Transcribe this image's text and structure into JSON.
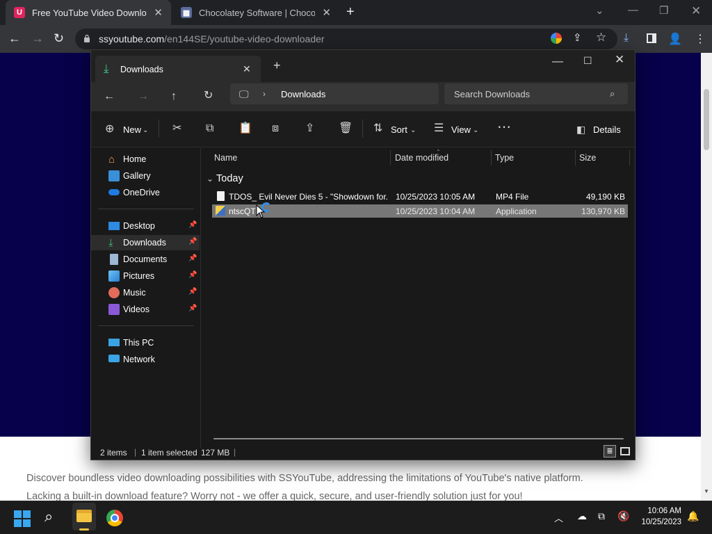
{
  "browser": {
    "tabs": [
      {
        "title": "Free YouTube Video Downloader",
        "favicon": "ssyoutube-logo-icon"
      },
      {
        "title": "Chocolatey Software | Chocolatey",
        "favicon": "chocolatey-logo-icon"
      }
    ],
    "url_domain": "ssyoutube.com",
    "url_path": "/en144SE/youtube-video-downloader"
  },
  "webpage": {
    "line1": "Discover boundless video downloading possibilities with SSYouTube, addressing the limitations of YouTube's native platform.",
    "line2": "Lacking a built-in download feature? Worry not - we offer a quick, secure, and user-friendly solution just for you!",
    "hero_color": "#07004a"
  },
  "explorer": {
    "tab_title": "Downloads",
    "breadcrumb": "Downloads",
    "search_placeholder": "Search Downloads",
    "commands": {
      "new": "New",
      "sort": "Sort",
      "view": "View",
      "details": "Details"
    },
    "nav_group1": [
      {
        "label": "Home",
        "icon": "home-icon"
      },
      {
        "label": "Gallery",
        "icon": "gallery-icon"
      },
      {
        "label": "OneDrive",
        "icon": "onedrive-icon"
      }
    ],
    "nav_group2": [
      {
        "label": "Desktop",
        "icon": "desktop-icon"
      },
      {
        "label": "Downloads",
        "icon": "download-arrow-icon",
        "selected": true
      },
      {
        "label": "Documents",
        "icon": "documents-icon"
      },
      {
        "label": "Pictures",
        "icon": "pictures-icon"
      },
      {
        "label": "Music",
        "icon": "music-icon"
      },
      {
        "label": "Videos",
        "icon": "videos-icon"
      }
    ],
    "nav_group3": [
      {
        "label": "This PC",
        "icon": "this-pc-icon"
      },
      {
        "label": "Network",
        "icon": "network-icon"
      }
    ],
    "columns": {
      "name": "Name",
      "date": "Date modified",
      "type": "Type",
      "size": "Size"
    },
    "group_label": "Today",
    "files": [
      {
        "name": "TDOS_ Evil Never Dies 5 - \"Showdown for...",
        "date": "10/25/2023 10:05 AM",
        "type": "MP4 File",
        "size": "49,190 KB",
        "selected": false
      },
      {
        "name": "ntscQT",
        "date": "10/25/2023 10:04 AM",
        "type": "Application",
        "size": "130,970 KB",
        "selected": true
      }
    ],
    "status": {
      "items": "2 items",
      "selected": "1 item selected",
      "size": "127 MB"
    }
  },
  "taskbar": {
    "time": "10:06 AM",
    "date": "10/25/2023"
  }
}
